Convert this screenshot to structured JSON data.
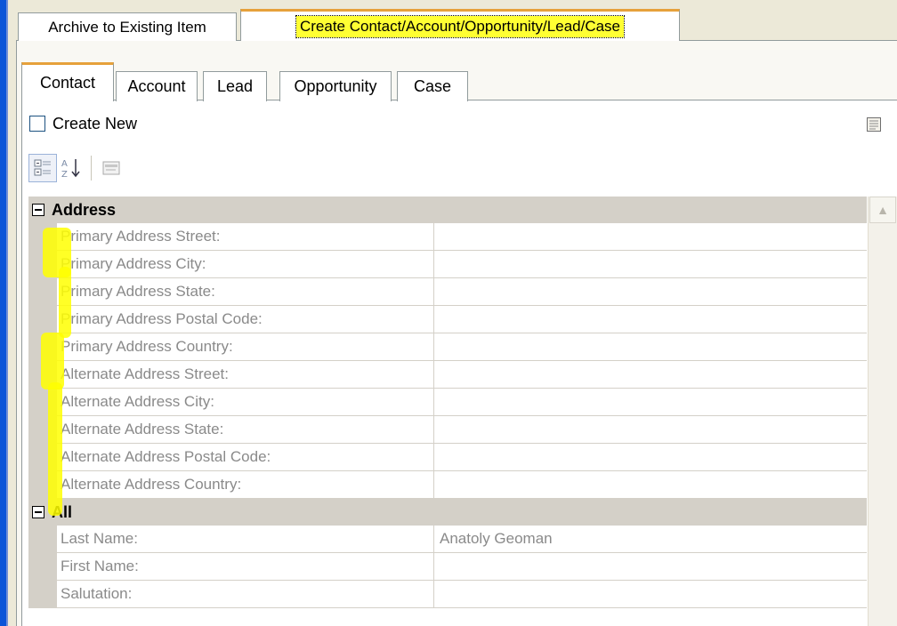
{
  "top_tabs": [
    {
      "label": "Archive to Existing Item"
    },
    {
      "label": "Create Contact/Account/Opportunity/Lead/Case"
    }
  ],
  "inner_tabs": [
    {
      "label": "Contact"
    },
    {
      "label": "Account"
    },
    {
      "label": "Lead"
    },
    {
      "label": "Opportunity"
    },
    {
      "label": "Case"
    }
  ],
  "create_new": {
    "label": "Create New",
    "checked": false
  },
  "toolbar": {
    "categorized_icon": "categorized-view-icon",
    "alphabetical_icon": "sort-az-icon",
    "property_pages_icon": "property-pages-icon"
  },
  "grid": {
    "address": {
      "title": "Address",
      "rows": [
        {
          "name": "Primary Address Street:",
          "value": ""
        },
        {
          "name": "Primary Address City:",
          "value": ""
        },
        {
          "name": "Primary Address State:",
          "value": ""
        },
        {
          "name": "Primary Address Postal Code:",
          "value": ""
        },
        {
          "name": "Primary Address Country:",
          "value": ""
        },
        {
          "name": "Alternate Address Street:",
          "value": ""
        },
        {
          "name": "Alternate Address City:",
          "value": ""
        },
        {
          "name": "Alternate Address State:",
          "value": ""
        },
        {
          "name": "Alternate Address Postal Code:",
          "value": ""
        },
        {
          "name": "Alternate Address Country:",
          "value": ""
        }
      ]
    },
    "all": {
      "title": "All",
      "rows": [
        {
          "name": "Last Name:",
          "value": "Anatoly Geoman"
        },
        {
          "name": "First Name:",
          "value": ""
        },
        {
          "name": "Salutation:",
          "value": ""
        }
      ]
    }
  },
  "colors": {
    "highlight": "#ffff00",
    "active_tab_border": "#e6a13b",
    "frame": "#0a54d8"
  }
}
